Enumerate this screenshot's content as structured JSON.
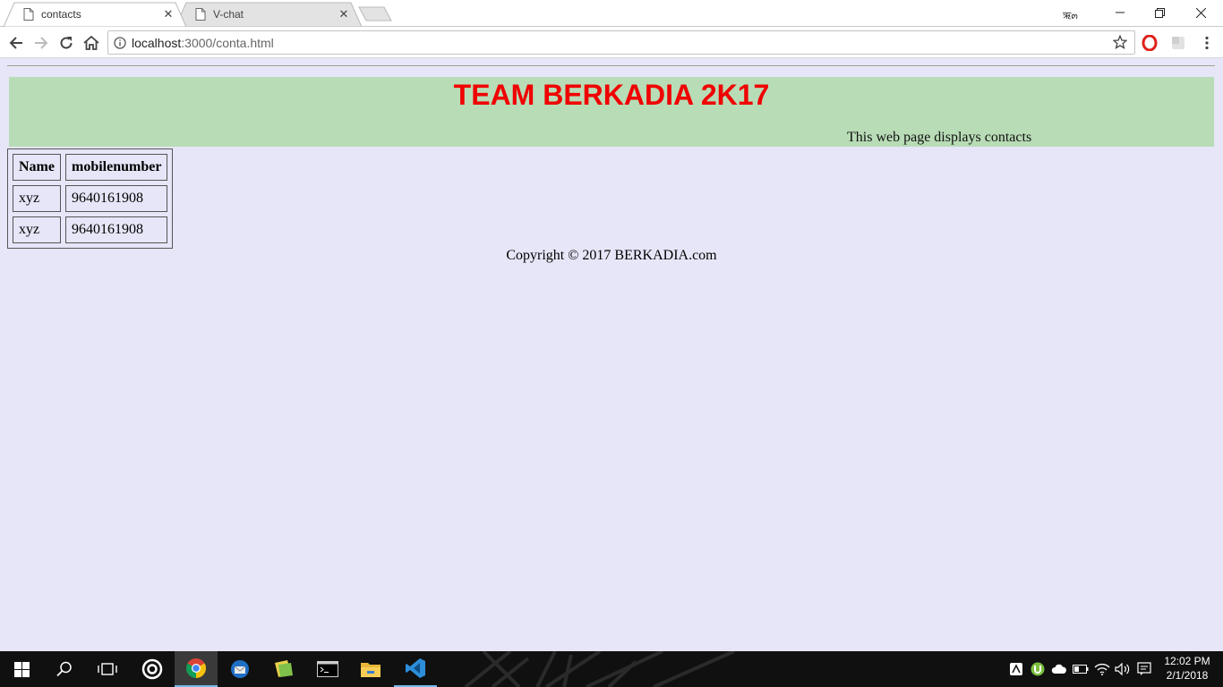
{
  "browser": {
    "tabs": [
      {
        "title": "contacts",
        "active": true
      },
      {
        "title": "V-chat",
        "active": false
      }
    ],
    "user_label": "ऋ๓",
    "url_host": "localhost",
    "url_path": ":3000/conta.html"
  },
  "page": {
    "banner_title": "TEAM BERKADIA 2K17",
    "banner_subtitle": "This web page displays contacts",
    "table": {
      "headers": [
        "Name",
        "mobilenumber"
      ],
      "rows": [
        [
          "xyz",
          "9640161908"
        ],
        [
          "xyz",
          "9640161908"
        ]
      ]
    },
    "copyright": "Copyright © 2017 BERKADIA.com"
  },
  "taskbar": {
    "time": "12:02 PM",
    "date": "2/1/2018"
  },
  "colors": {
    "page_bg": "#e6e6f8",
    "banner_bg": "#b8dcb6",
    "banner_title": "#f00000",
    "taskbar_bg": "#101010",
    "accent": "#76b9ed"
  }
}
